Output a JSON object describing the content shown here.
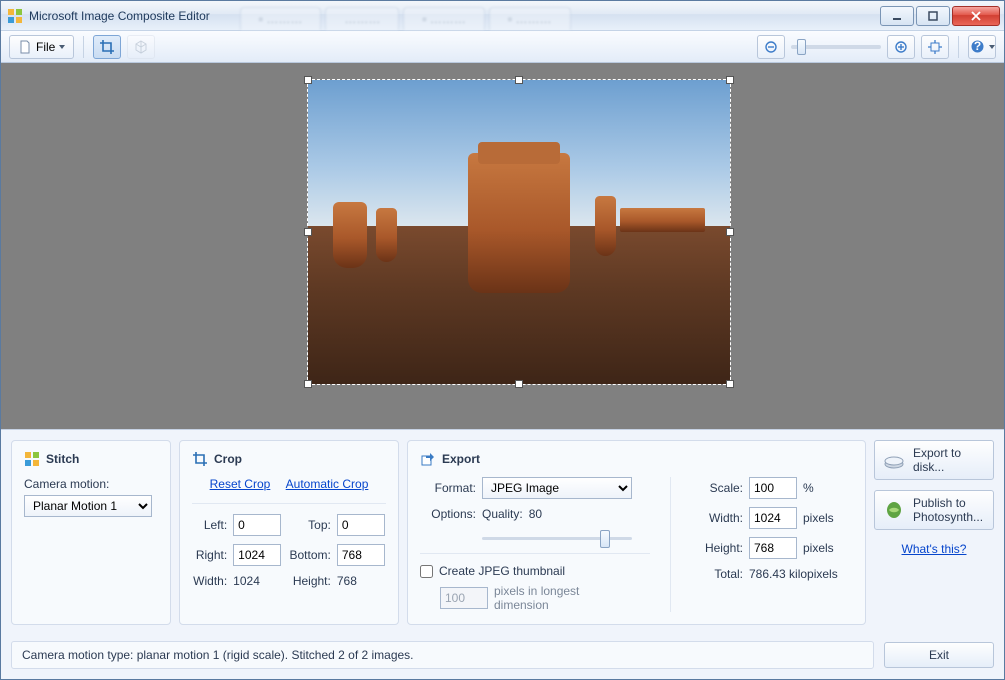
{
  "app": {
    "title": "Microsoft Image Composite Editor"
  },
  "toolbar": {
    "file_label": "File"
  },
  "stitch": {
    "heading": "Stitch",
    "camera_motion_label": "Camera motion:",
    "camera_motion_value": "Planar Motion 1"
  },
  "crop": {
    "heading": "Crop",
    "reset_link": "Reset Crop",
    "auto_link": "Automatic Crop",
    "left_label": "Left:",
    "left_value": "0",
    "top_label": "Top:",
    "top_value": "0",
    "right_label": "Right:",
    "right_value": "1024",
    "bottom_label": "Bottom:",
    "bottom_value": "768",
    "width_label": "Width:",
    "width_value": "1024",
    "height_label": "Height:",
    "height_value": "768"
  },
  "export": {
    "heading": "Export",
    "format_label": "Format:",
    "format_value": "JPEG Image",
    "options_label": "Options:",
    "quality_label": "Quality:",
    "quality_value": "80",
    "create_thumb_label": "Create JPEG thumbnail",
    "thumb_value": "100",
    "thumb_suffix": "pixels in longest dimension",
    "scale_label": "Scale:",
    "scale_value": "100",
    "scale_unit": "%",
    "width_label": "Width:",
    "width_value": "1024",
    "px_unit": "pixels",
    "height_label": "Height:",
    "height_value": "768",
    "total_label": "Total:",
    "total_value": "786.43 kilopixels"
  },
  "right": {
    "export_disk": "Export to disk...",
    "publish": "Publish to Photosynth...",
    "whats_this": "What's this?"
  },
  "status": {
    "text": "Camera motion type: planar motion 1 (rigid scale). Stitched 2 of 2 images."
  },
  "exit": {
    "label": "Exit"
  }
}
